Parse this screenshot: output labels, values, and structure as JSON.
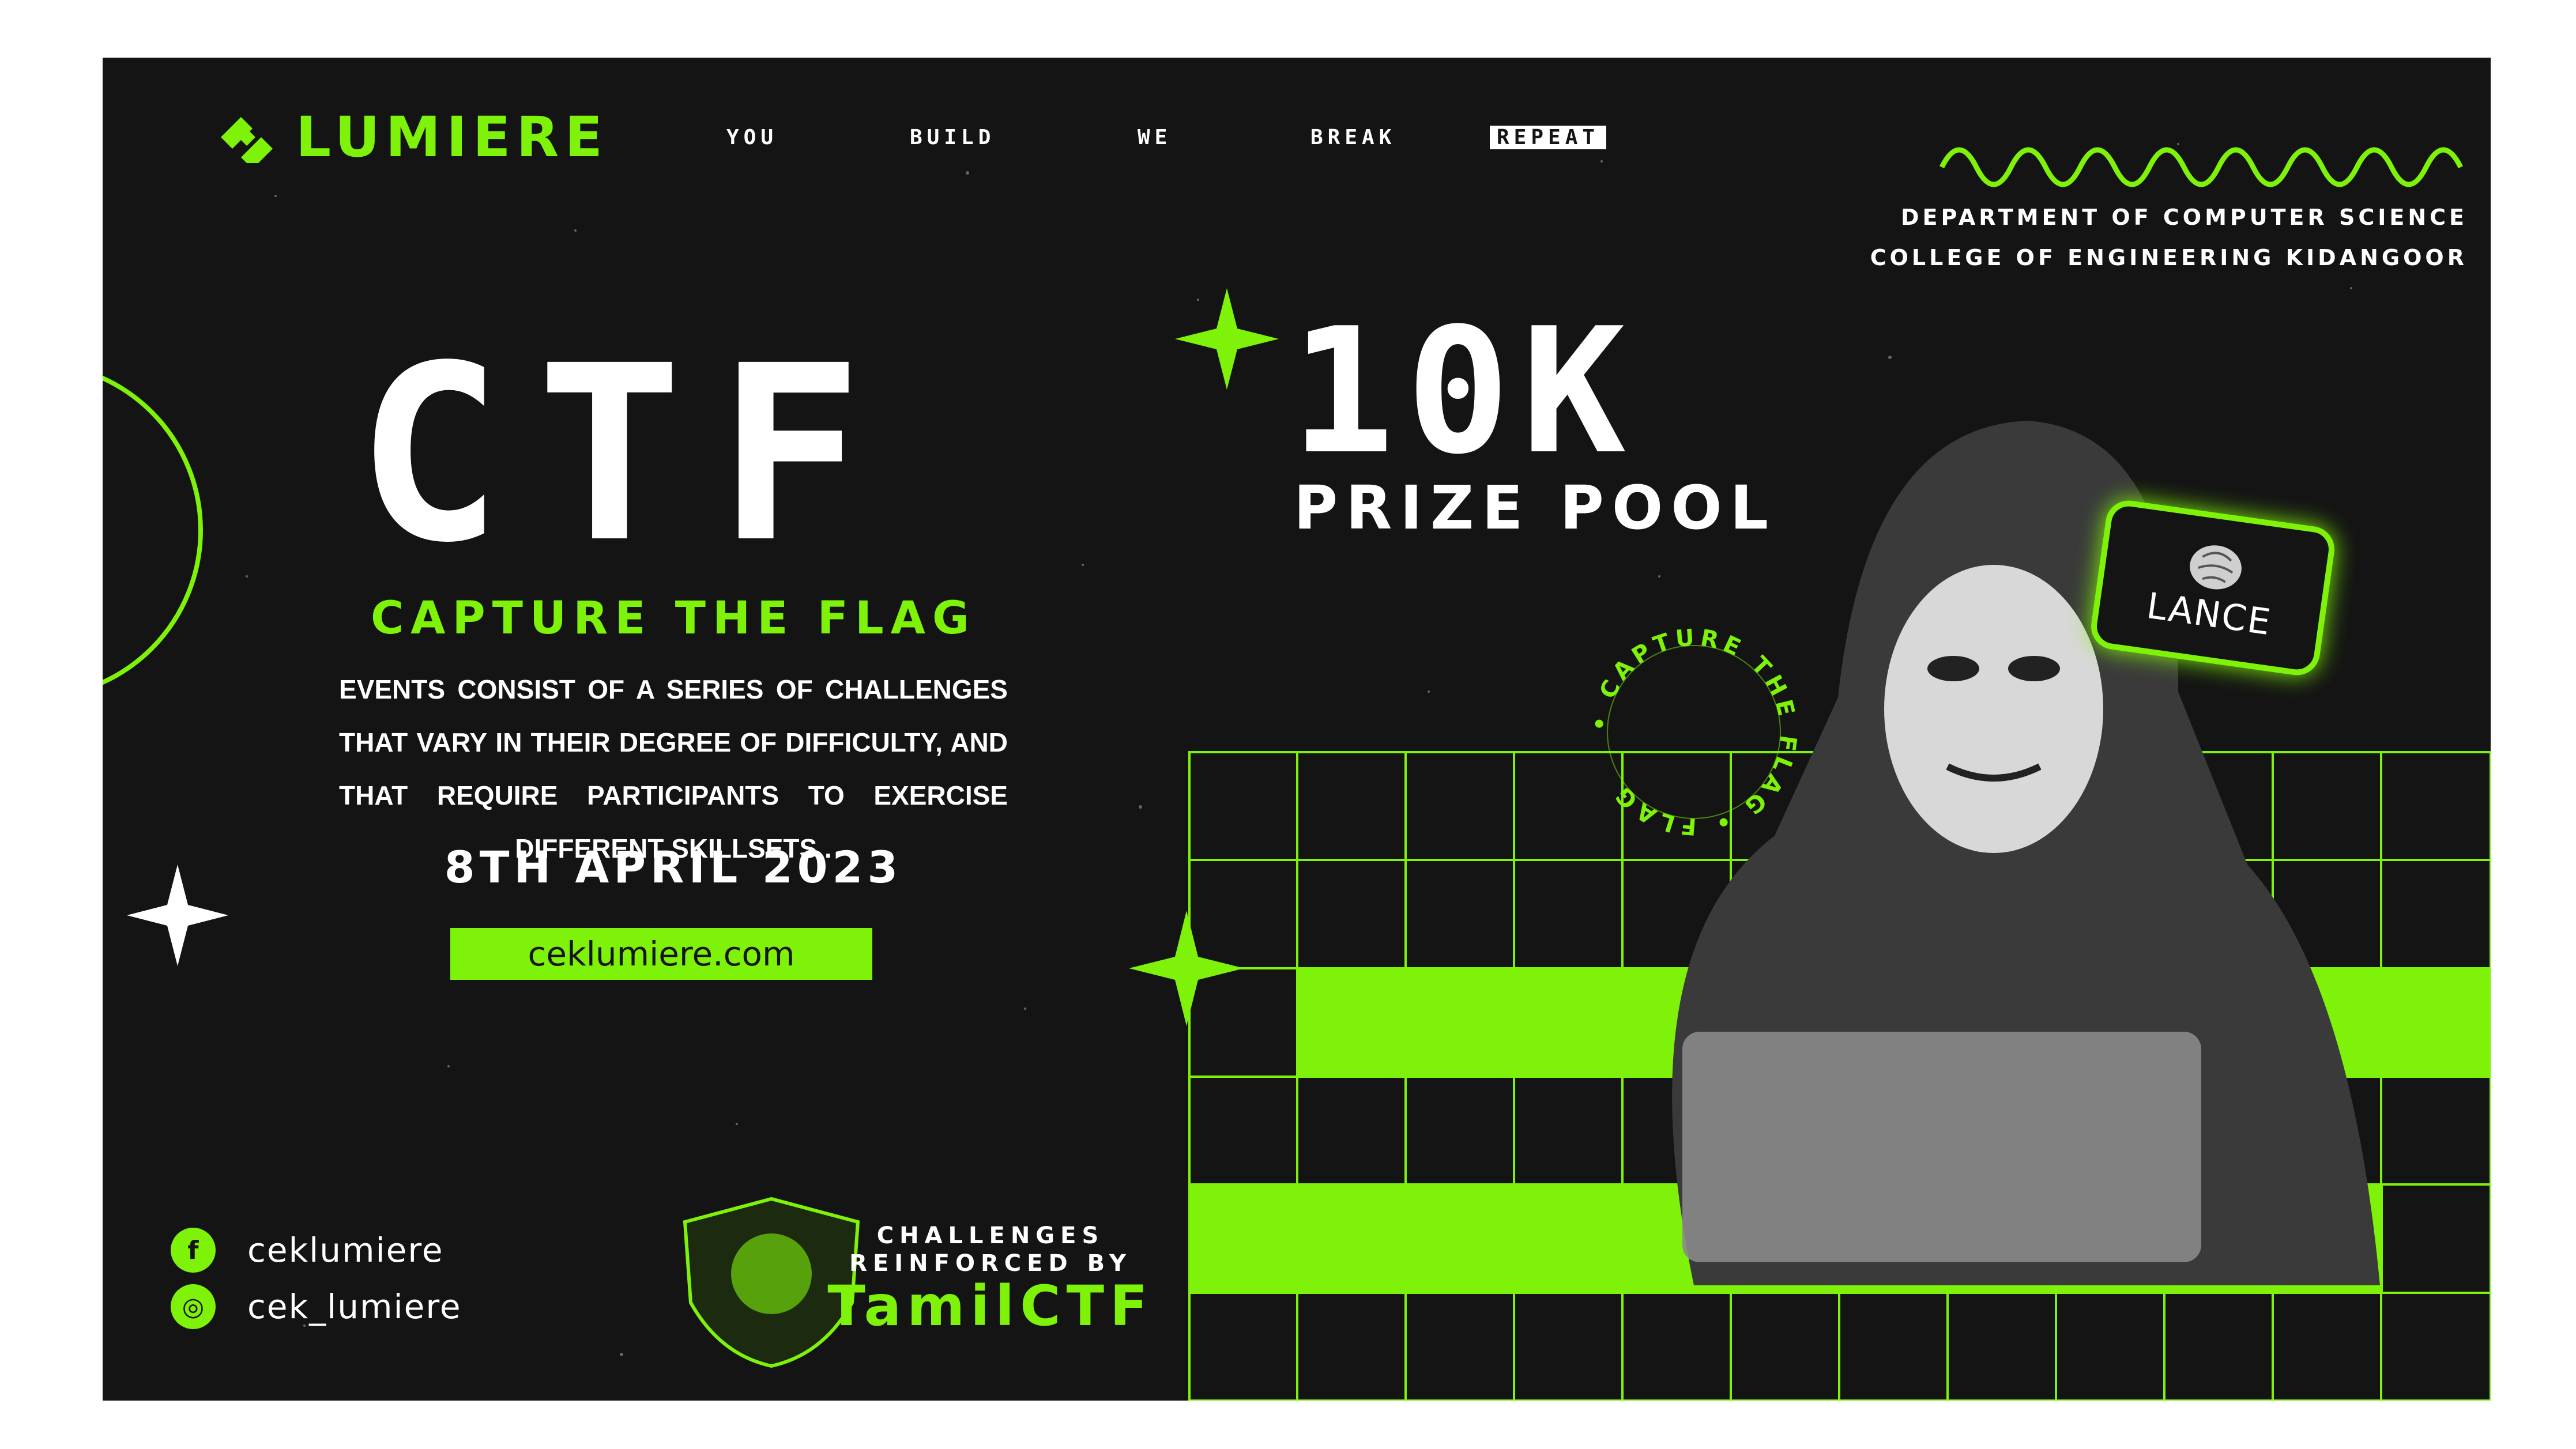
{
  "brand": {
    "name": "LUMIERE",
    "accent": "#7ff20a",
    "background": "#141414",
    "text": "#ffffff"
  },
  "nav": {
    "items": [
      "YOU",
      "BUILD",
      "WE",
      "BREAK",
      "REPEAT"
    ],
    "highlighted": "REPEAT"
  },
  "department": {
    "line1": "DEPARTMENT OF COMPUTER SCIENCE",
    "line2": "COLLEGE OF ENGINEERING KIDANGOOR"
  },
  "hero": {
    "title": "CTF",
    "subtitle": "CAPTURE THE FLAG",
    "description": "EVENTS CONSIST OF A SERIES OF CHALLENGES THAT VARY IN THEIR DEGREE OF DIFFICULTY, AND THAT REQUIRE PARTICIPANTS TO EXERCISE DIFFERENT SKILLSETS .",
    "date": "8TH APRIL 2023",
    "website": "ceklumiere.com"
  },
  "prize": {
    "amount": "10K",
    "label": "PRIZE POOL"
  },
  "badge": {
    "circular_text": "• CAPTURE THE FLAG • FLAG"
  },
  "sponsor": {
    "name": "LANCE"
  },
  "social": {
    "facebook": {
      "icon": "facebook-icon",
      "handle": "ceklumiere"
    },
    "instagram": {
      "icon": "instagram-icon",
      "handle": "cek_lumiere"
    }
  },
  "partner": {
    "line1": "CHALLENGES",
    "line2": "REINFORCED BY",
    "name": "TamilCTF"
  }
}
